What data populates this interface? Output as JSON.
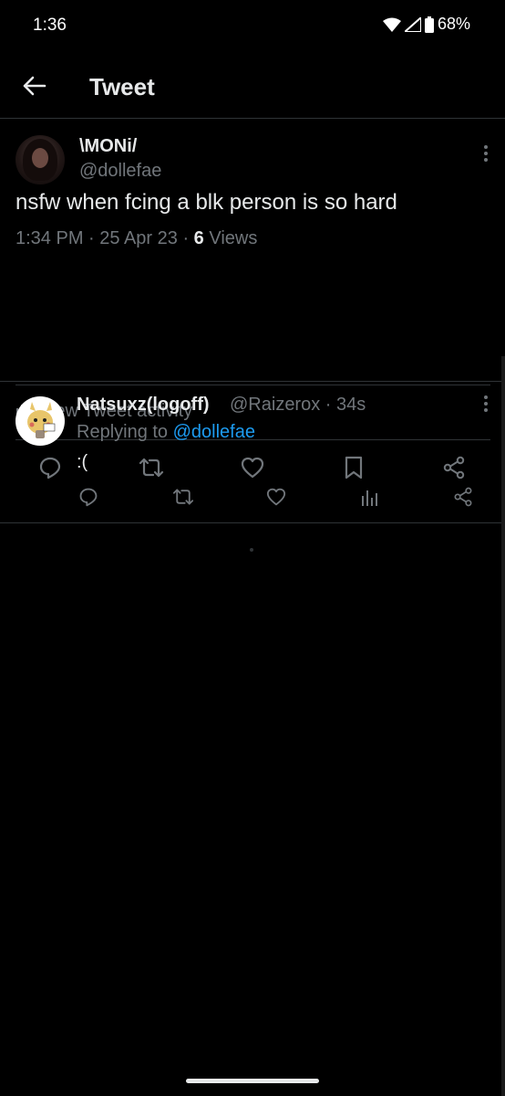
{
  "status_bar": {
    "time": "1:36",
    "battery": "68%"
  },
  "header": {
    "title": "Tweet"
  },
  "main_tweet": {
    "author_name": "\\MONi/",
    "author_handle": "@dollefae",
    "text": "nsfw when fcing a blk person is so hard",
    "time": "1:34 PM",
    "sep1": " · ",
    "date": "25 Apr 23",
    "sep2": " · ",
    "views_count": "6",
    "views_label": " Views",
    "activity_label": "View Tweet activity",
    "icons": [
      "reply-icon",
      "retweet-icon",
      "like-icon",
      "bookmark-icon",
      "share-icon"
    ]
  },
  "reply": {
    "author_name": "Natsuxz(logoff)",
    "author_handle": "@Raizerox · 34s",
    "replying_prefix": "Replying to ",
    "replying_mention": "@dollefae",
    "text": ":(",
    "icons": [
      "reply-icon",
      "retweet-icon",
      "like-icon",
      "views-icon",
      "share-icon"
    ]
  },
  "colors": {
    "background": "#000000",
    "text_primary": "#e7e9ea",
    "text_secondary": "#71767b",
    "link": "#1d9bf0",
    "divider": "#2f3336"
  }
}
